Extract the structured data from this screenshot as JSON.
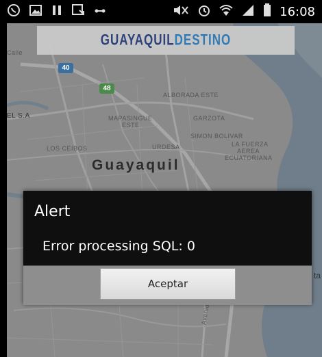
{
  "status_bar": {
    "time": "16:08",
    "icons": [
      "whatsapp-icon",
      "image-icon",
      "pause-icon",
      "download-icon",
      "dots-icon",
      "mute-icon",
      "alarm-icon",
      "wifi-icon",
      "signal-icon",
      "battery-icon"
    ]
  },
  "map": {
    "logo": {
      "text_main": "GUAYAQUIL",
      "text_accent": "DESTINO"
    },
    "labels": {
      "calle": "Calle",
      "road_40": "40",
      "road_48": "48",
      "el_sa": "EL S.A",
      "alborada_este": "ALBORADA ESTE",
      "mapasingue_este_1": "MAPASINGUE",
      "mapasingue_este_2": "ESTE",
      "garzota": "GARZOTA",
      "simon_bolivar": "SIMON BOLIVAR",
      "la_fuerza_1": "LA FUERZA",
      "la_fuerza_2": "AEREA",
      "la_fuerza_3": "ECUATORIANA",
      "los_ceibos": "LOS CEIBOS",
      "urdesa": "URDESA",
      "city": "Guayaquil",
      "right_edge": "ta",
      "avenida": "Avenida 25 De Julio"
    }
  },
  "alert": {
    "title": "Alert",
    "message": "Error processing SQL: 0",
    "button_label": "Aceptar"
  },
  "colors": {
    "alert_header_bg": "#0f0f0f",
    "alert_footer_bg": "#8e8e8e",
    "map_land": "#8b8b8b",
    "map_water": "#6d7f8f"
  }
}
